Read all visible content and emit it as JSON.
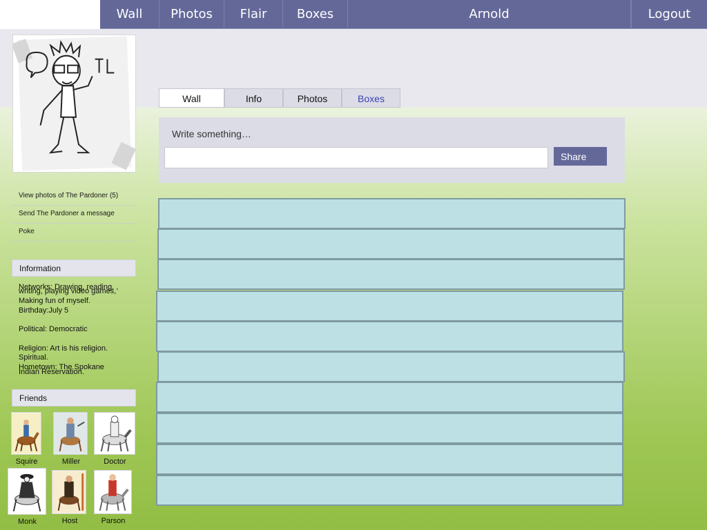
{
  "topbar": {
    "nav": [
      "Wall",
      "Photos",
      "Flair",
      "Boxes"
    ],
    "user": "Arnold",
    "logout": "Logout"
  },
  "sidebar": {
    "links": [
      "View photos of The Pardoner (5)",
      "Send The Pardoner a message",
      "Poke"
    ],
    "information_title": "Information",
    "info": {
      "networks_line1": "Networks: Drawing, reading, ,",
      "networks_line2": "writing, playing video games,",
      "networks_line3": "Making fun of myself.",
      "birthday": "Birthday:July 5",
      "political": "Political: Democratic",
      "religion_line1": "Religion: Art is his religion.",
      "religion_line2": "Spiritual.",
      "hometown_line1": "Hometown: The Spokane",
      "hometown_line2": "Indian Reservation."
    },
    "friends_title": "Friends",
    "friends": [
      "Squire",
      "Miller",
      "Doctor",
      "Monk",
      "Host",
      "Parson"
    ]
  },
  "tabs": [
    "Wall",
    "Info",
    "Photos",
    "Boxes"
  ],
  "composer": {
    "label": "Write something…",
    "value": "",
    "share": "Share"
  },
  "wall_post_count": 10
}
